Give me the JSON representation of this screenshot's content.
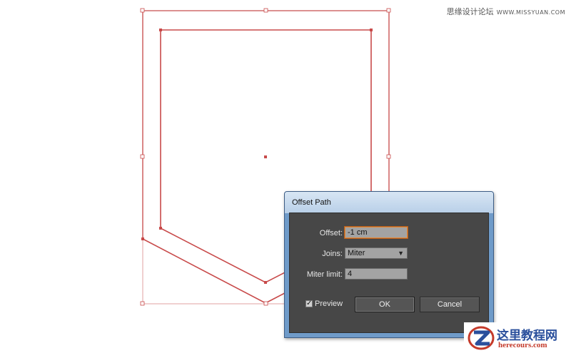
{
  "watermark_top": {
    "site": "思缘设计论坛",
    "url": "WWW.MISSYUAN.COM"
  },
  "dialog": {
    "title": "Offset Path",
    "offset_label": "Offset:",
    "offset_value": "-1 cm",
    "joins_label": "Joins:",
    "joins_value": "Miter",
    "miter_limit_label": "Miter limit:",
    "miter_limit_value": "4",
    "preview_label": "Preview",
    "preview_checked": true,
    "ok_label": "OK",
    "cancel_label": "Cancel"
  },
  "logo": {
    "text": "这里教程网",
    "url": "herecours.com"
  },
  "colors": {
    "path_stroke": "#c84a4a",
    "dialog_body": "#474747",
    "titlebar": "#c8dbee"
  },
  "icons": {
    "dropdown": "chevron-down-icon",
    "checkbox": "checkmark-icon",
    "anchor": "anchor-point-icon"
  }
}
